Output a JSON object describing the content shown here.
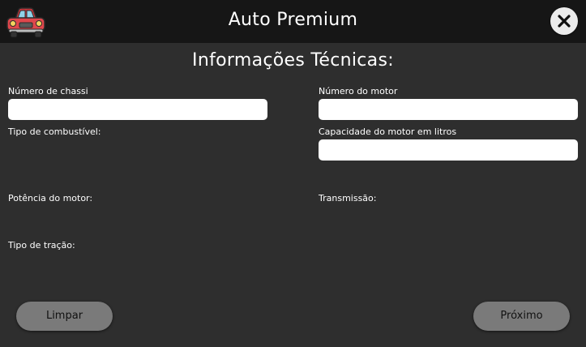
{
  "app": {
    "title": "Auto Premium",
    "logo_icon": "red-car-icon",
    "close_icon": "close-icon"
  },
  "form": {
    "title": "Informações Técnicas:",
    "chassis_label": "Número de chassi",
    "chassis_value": "",
    "engine_number_label": "Número do motor",
    "engine_number_value": "",
    "fuel_type_label": "Tipo de combustível:",
    "engine_capacity_label": "Capacidade do motor em litros",
    "engine_capacity_value": "",
    "engine_power_label": "Potência do motor:",
    "transmission_label": "Transmissão:",
    "traction_label": "Tipo de tração:"
  },
  "buttons": {
    "clear_label": "Limpar",
    "next_label": "Próximo"
  },
  "colors": {
    "background": "#2e2e2e",
    "titlebar": "#161616",
    "button": "#7a7a7a",
    "logo_red": "#e0474c"
  }
}
